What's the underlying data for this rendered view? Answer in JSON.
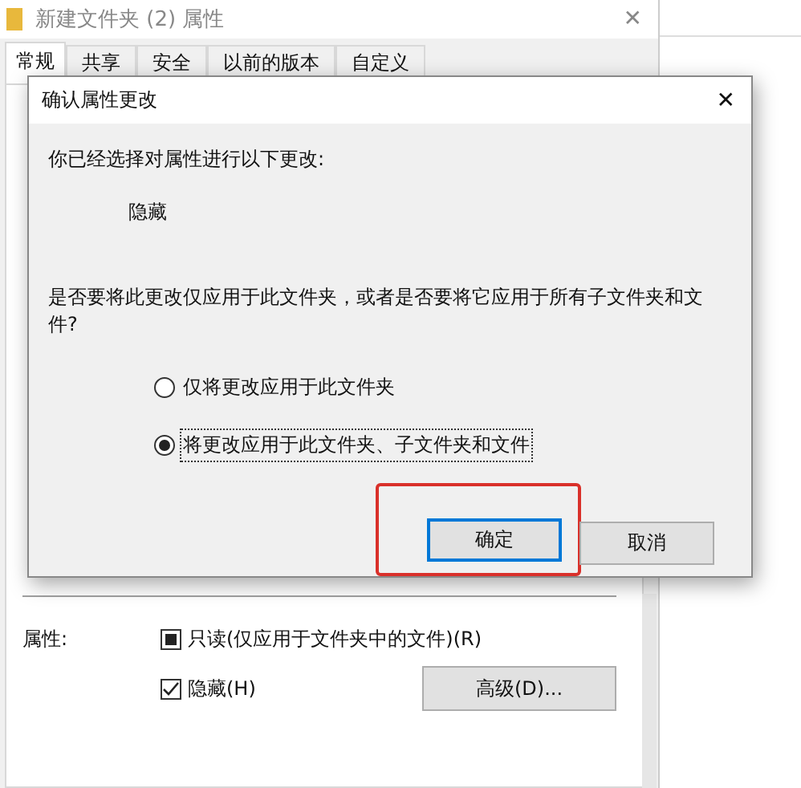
{
  "window": {
    "title": "新建文件夹 (2) 属性",
    "close": "✕"
  },
  "tabs": [
    {
      "label": "常规",
      "selected": true
    },
    {
      "label": "共享",
      "selected": false
    },
    {
      "label": "安全",
      "selected": false
    },
    {
      "label": "以前的版本",
      "selected": false
    },
    {
      "label": "自定义",
      "selected": false
    }
  ],
  "attributes": {
    "label": "属性:",
    "checkboxes": [
      {
        "label": "只读(仅应用于文件夹中的文件)(R)",
        "checked": false,
        "mixed": true
      },
      {
        "label": "隐藏(H)",
        "checked": true,
        "mixed": false
      }
    ],
    "advanced_button": "高级(D)..."
  },
  "dialog": {
    "title": "确认属性更改",
    "close": "✕",
    "intro": "你已经选择对属性进行以下更改:",
    "change": "隐藏",
    "question": "是否要将此更改仅应用于此文件夹，或者是否要将它应用于所有子文件夹和文件?",
    "options": [
      {
        "label": "仅将更改应用于此文件夹",
        "selected": false
      },
      {
        "label": "将更改应用于此文件夹、子文件夹和文件",
        "selected": true
      }
    ],
    "buttons": [
      {
        "label": "确定",
        "default": true,
        "highlighted": true
      },
      {
        "label": "取消",
        "default": false,
        "highlighted": false
      }
    ]
  }
}
